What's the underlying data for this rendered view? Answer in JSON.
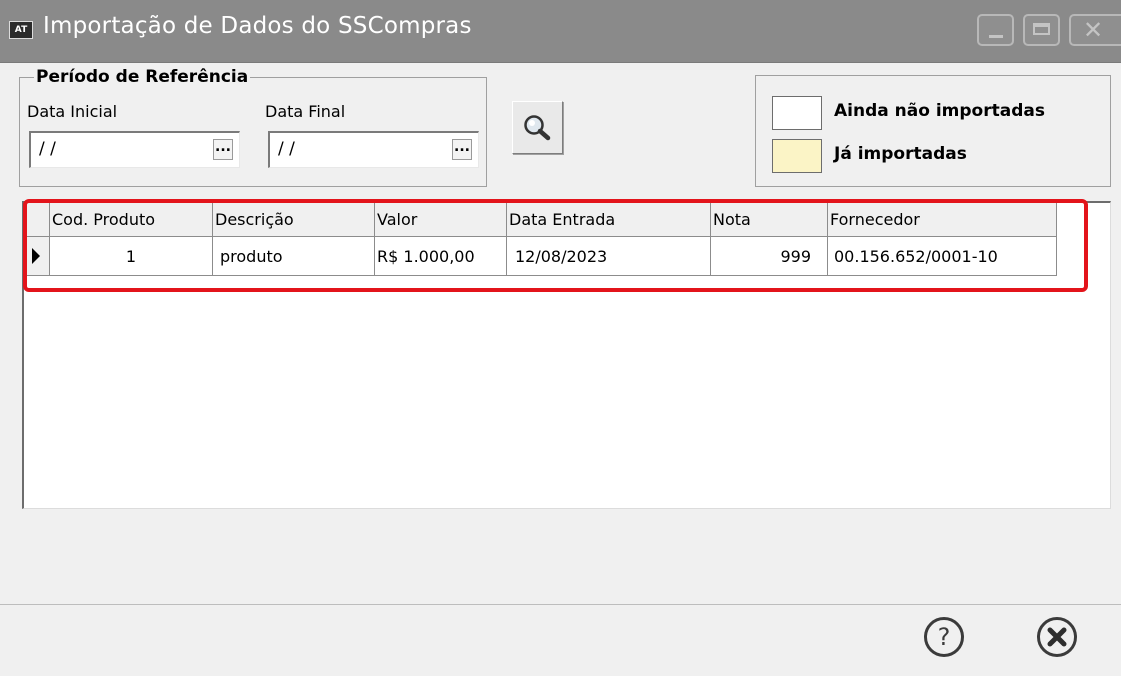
{
  "window": {
    "icon_text": "AT",
    "title": "Importação de Dados do SSCompras"
  },
  "period": {
    "title": "Período de Referência",
    "start_label": "Data Inicial",
    "start_value": "/ /",
    "end_label": "Data Final",
    "end_value": "/ /",
    "dots": "..."
  },
  "legend": {
    "not_imported": {
      "label": "Ainda não importadas",
      "color": "#ffffff"
    },
    "imported": {
      "label": "Já importadas",
      "color": "#fbf4c6"
    }
  },
  "grid": {
    "columns": [
      "Cod. Produto",
      "Descrição",
      "Valor",
      "Data Entrada",
      "Nota",
      "Fornecedor"
    ],
    "rows": [
      {
        "cod": "1",
        "descricao": "produto",
        "valor": "R$ 1.000,00",
        "data": "12/08/2023",
        "nota": "999",
        "fornecedor": "00.156.652/0001-10"
      }
    ]
  },
  "colors": {
    "highlight": "#e3141b",
    "titlebar": "#8a8a8a"
  },
  "icons": {
    "search": "magnifier-icon",
    "help": "question-icon",
    "close": "close-circle-icon"
  }
}
